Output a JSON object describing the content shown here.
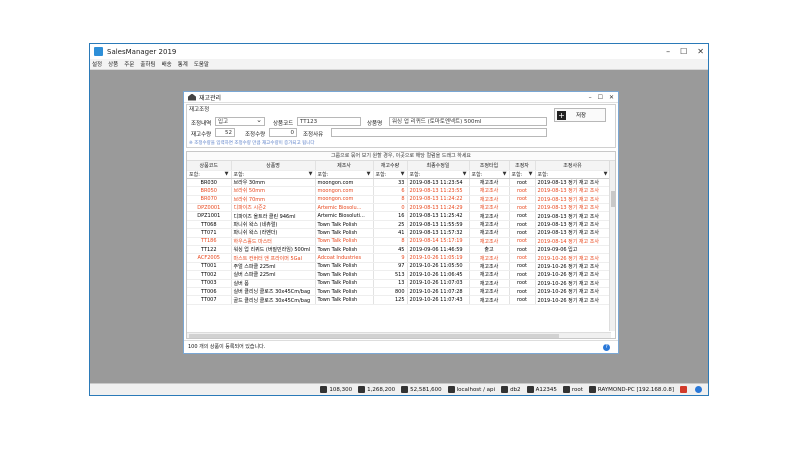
{
  "app": {
    "title": "SalesManager 2019"
  },
  "menu": [
    "설정",
    "상품",
    "주문",
    "출하팀",
    "배송",
    "통계",
    "도움말"
  ],
  "window": {
    "title": "재고관리"
  },
  "form": {
    "group_label": "재고조정",
    "type_label": "조정내역",
    "type_value": "입고",
    "code_label": "상품코드",
    "code_value": "TT123",
    "name_label": "상품명",
    "name_value": "워싱 업 리퀴드 (토마토엔넥트) 500ml",
    "stock_label": "재고수량",
    "stock_value": "52",
    "adjust_label": "조정수량",
    "adjust_value": "0",
    "reason_label": "조정사유",
    "reason_value": "",
    "save_label": "저장",
    "note": "※ 조정수량을 입력하면 조정수량 만큼 재고수량이 증가되고 됩니다"
  },
  "grid": {
    "banner": "그룹으로 묶어 보기 원할 경우, 이곳으로 해당 컬럼을 드래그 하세요",
    "columns": [
      "상품코드",
      "상품명",
      "제조사",
      "재고수량",
      "최종수정일",
      "조정타입",
      "조정자",
      "조정사유"
    ],
    "filter_label": "포함:",
    "rows": [
      {
        "code": "BR030",
        "name": "브라우 30mm",
        "maker": "moongon.com",
        "qty": "33",
        "date": "2019-08-13 11:23:54",
        "type": "재고조사",
        "user": "root",
        "reason": "2019-08-13 정기 재고 조사",
        "red": false
      },
      {
        "code": "BR050",
        "name": "브라쉬 50mm",
        "maker": "moongon.com",
        "qty": "6",
        "date": "2019-08-13 11:23:55",
        "type": "재고조사",
        "user": "root",
        "reason": "2019-08-13 정기 재고 조사",
        "red": true
      },
      {
        "code": "BR070",
        "name": "브라쉬 70mm",
        "maker": "moongon.com",
        "qty": "8",
        "date": "2019-08-13 11:24:22",
        "type": "재고조사",
        "user": "root",
        "reason": "2019-08-13 정기 재고 조사",
        "red": true
      },
      {
        "code": "DPZ0001",
        "name": "디파이즈 시즌2",
        "maker": "Artemic Biosolu...",
        "qty": "0",
        "date": "2019-08-13 11:24:29",
        "type": "재고조사",
        "user": "root",
        "reason": "2019-08-13 정기 재고 조사",
        "red": true
      },
      {
        "code": "DPZ1001",
        "name": "디파이즈 올트라 클린 946ml",
        "maker": "Artemic Biosoluti...",
        "qty": "16",
        "date": "2019-08-13 11:25:42",
        "type": "재고조사",
        "user": "root",
        "reason": "2019-08-13 정기 재고 조사",
        "red": false
      },
      {
        "code": "TT068",
        "name": "파니쉬 왁스 (네츄럴)",
        "maker": "Town Talk Polish",
        "qty": "25",
        "date": "2019-08-13 11:55:59",
        "type": "재고조사",
        "user": "root",
        "reason": "2019-08-13 정기 재고 조사",
        "red": false
      },
      {
        "code": "TT071",
        "name": "파니쉬 왁스 (라벤더)",
        "maker": "Town Talk Polish",
        "qty": "41",
        "date": "2019-08-13 11:57:32",
        "type": "재고조사",
        "user": "root",
        "reason": "2019-08-13 정기 재고 조사",
        "red": false
      },
      {
        "code": "TT186",
        "name": "하우스홀드 마스터",
        "maker": "Town Talk Polish",
        "qty": "8",
        "date": "2019-08-14 15:17:19",
        "type": "재고조사",
        "user": "root",
        "reason": "2019-08-14 정기 재고 조사",
        "red": true
      },
      {
        "code": "TT122",
        "name": "워싱 업 리퀴드 (버질민라임) 500ml",
        "maker": "Town Talk Polish",
        "qty": "45",
        "date": "2019-09-06 11:46:59",
        "type": "출고",
        "user": "root",
        "reason": "2019-09-06 입고",
        "red": false
      },
      {
        "code": "ACF2005",
        "name": "마스트 컨버터 앤 프라이머 5Gal",
        "maker": "Adcoat Industries",
        "qty": "9",
        "date": "2019-10-26 11:05:19",
        "type": "재고조사",
        "user": "root",
        "reason": "2019-10-26 정기 재고 조사",
        "red": true
      },
      {
        "code": "TT001",
        "name": "주얼 스파클 225ml",
        "maker": "Town Talk Polish",
        "qty": "97",
        "date": "2019-10-26 11:05:50",
        "type": "재고조사",
        "user": "root",
        "reason": "2019-10-26 정기 재고 조사",
        "red": false
      },
      {
        "code": "TT002",
        "name": "실버 스파클 225ml",
        "maker": "Town Talk Polish",
        "qty": "513",
        "date": "2019-10-26 11:06:45",
        "type": "재고조사",
        "user": "root",
        "reason": "2019-10-26 정기 재고 조사",
        "red": false
      },
      {
        "code": "TT003",
        "name": "실버 폼",
        "maker": "Town Talk Polish",
        "qty": "13",
        "date": "2019-10-26 11:07:03",
        "type": "재고조사",
        "user": "root",
        "reason": "2019-10-26 정기 재고 조사",
        "red": false
      },
      {
        "code": "TT006",
        "name": "실버 클리닝 클로즈 30x45Cm/bag",
        "maker": "Town Talk Polish",
        "qty": "800",
        "date": "2019-10-26 11:07:28",
        "type": "재고조사",
        "user": "root",
        "reason": "2019-10-26 정기 재고 조사",
        "red": false
      },
      {
        "code": "TT007",
        "name": "골드 클리닝 클로즈 30x45Cm/bag",
        "maker": "Town Talk Polish",
        "qty": "125",
        "date": "2019-10-26 11:07:43",
        "type": "재고조사",
        "user": "root",
        "reason": "2019-10-26 정기 재고 조사",
        "red": false
      }
    ]
  },
  "child_status": "100 개의 상품이 등록되어 있습니다.",
  "statusbar": [
    "108,300",
    "1,268,200",
    "52,581,600",
    "localhost / api",
    "db2",
    "A12345",
    "root",
    "RAYMOND-PC [192.168.0.8]"
  ],
  "colors": {
    "accent": "#2b7ab8",
    "alert_row": "#e8481e",
    "workspace": "#9a9a9a"
  }
}
